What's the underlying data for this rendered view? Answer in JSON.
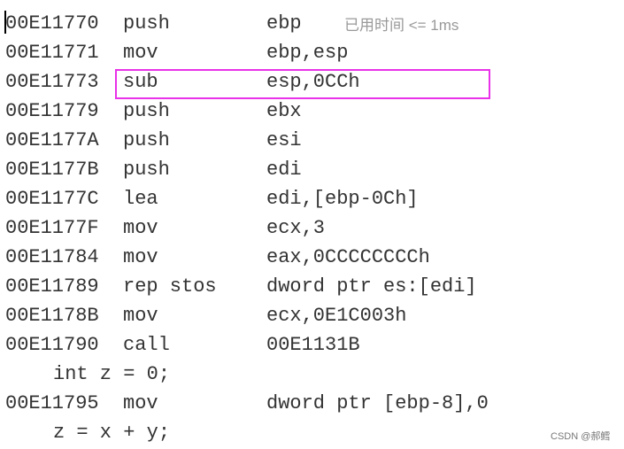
{
  "timing_hint": "已用时间 <= 1ms",
  "highlight_color": "#e932e9",
  "watermark": "CSDN @郝鳕",
  "rows": [
    {
      "type": "asm",
      "addr": "00E11770",
      "mn": "push",
      "op": "ebp"
    },
    {
      "type": "asm",
      "addr": "00E11771",
      "mn": "mov",
      "op": "ebp,esp"
    },
    {
      "type": "asm",
      "addr": "00E11773",
      "mn": "sub",
      "op": "esp,0CCh",
      "highlighted": true
    },
    {
      "type": "asm",
      "addr": "00E11779",
      "mn": "push",
      "op": "ebx"
    },
    {
      "type": "asm",
      "addr": "00E1177A",
      "mn": "push",
      "op": "esi"
    },
    {
      "type": "asm",
      "addr": "00E1177B",
      "mn": "push",
      "op": "edi"
    },
    {
      "type": "asm",
      "addr": "00E1177C",
      "mn": "lea",
      "op": "edi,[ebp-0Ch]"
    },
    {
      "type": "asm",
      "addr": "00E1177F",
      "mn": "mov",
      "op": "ecx,3"
    },
    {
      "type": "asm",
      "addr": "00E11784",
      "mn": "mov",
      "op": "eax,0CCCCCCCCh"
    },
    {
      "type": "asm",
      "addr": "00E11789",
      "mn": "rep stos",
      "op": "dword ptr es:[edi]"
    },
    {
      "type": "asm",
      "addr": "00E1178B",
      "mn": "mov",
      "op": "ecx,0E1C003h"
    },
    {
      "type": "asm",
      "addr": "00E11790",
      "mn": "call",
      "op": "00E1131B"
    },
    {
      "type": "src",
      "text": "int z = 0;"
    },
    {
      "type": "asm",
      "addr": "00E11795",
      "mn": "mov",
      "op": "dword ptr [ebp-8],0"
    },
    {
      "type": "src",
      "text": "z = x + y;"
    }
  ]
}
